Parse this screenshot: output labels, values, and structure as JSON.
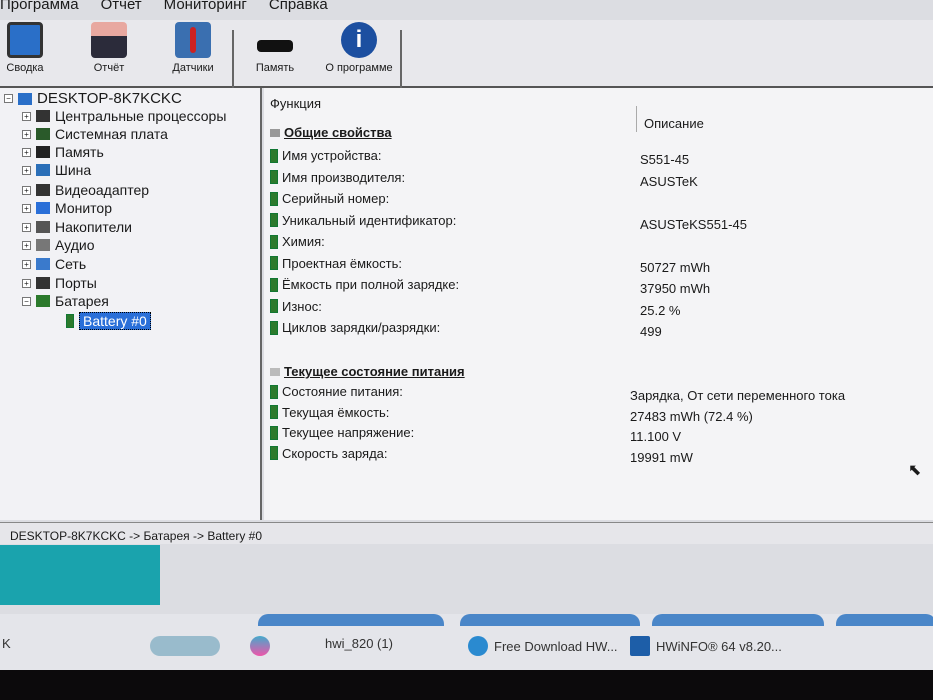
{
  "menu": [
    "Программа",
    "Отчет",
    "Мониторинг",
    "Справка"
  ],
  "toolbar": [
    {
      "label": "Сводка",
      "icon": "monitor-icon"
    },
    {
      "label": "Отчёт",
      "icon": "floppy-icon"
    },
    {
      "label": "Датчики",
      "icon": "thermometer-icon"
    },
    {
      "label": "Память",
      "icon": "memory-icon"
    },
    {
      "label": "О программе",
      "icon": "info-icon"
    }
  ],
  "tree": {
    "root": "DESKTOP-8K7KCKC",
    "items": [
      "Центральные процессоры",
      "Системная плата",
      "Память",
      "Шина",
      "Видеоадаптер",
      "Монитор",
      "Накопители",
      "Аудио",
      "Сеть",
      "Порты",
      "Батарея"
    ],
    "selected": "Battery #0"
  },
  "main": {
    "col_function": "Функция",
    "col_description": "Описание",
    "section1": "Общие свойства",
    "rows1": [
      {
        "k": "Имя устройства:",
        "v": "S551-45"
      },
      {
        "k": "Имя производителя:",
        "v": "ASUSTeK"
      },
      {
        "k": "Серийный номер:",
        "v": ""
      },
      {
        "k": "Уникальный идентификатор:",
        "v": "ASUSTeKS551-45"
      },
      {
        "k": "Химия:",
        "v": ""
      },
      {
        "k": "Проектная ёмкость:",
        "v": "50727 mWh"
      },
      {
        "k": "Ёмкость при полной зарядке:",
        "v": "37950 mWh"
      },
      {
        "k": "Износ:",
        "v": "25.2 %"
      },
      {
        "k": "Циклов зарядки/разрядки:",
        "v": "499"
      }
    ],
    "section2": "Текущее состояние питания",
    "rows2": [
      {
        "k": "Состояние питания:",
        "v": "Зарядка, От сети переменного тока"
      },
      {
        "k": "Текущая ёмкость:",
        "v": "27483 mWh (72.4 %)"
      },
      {
        "k": "Текущее напряжение:",
        "v": "11.100 V"
      },
      {
        "k": "Скорость заряда:",
        "v": "19991 mW"
      }
    ]
  },
  "status": "DESKTOP-8K7KCKC -> Батарея -> Battery #0",
  "taskbar": {
    "left": "K",
    "tasks": [
      "hwi_820 (1)",
      "Free Download HW...",
      "HWiNFO® 64 v8.20..."
    ]
  }
}
